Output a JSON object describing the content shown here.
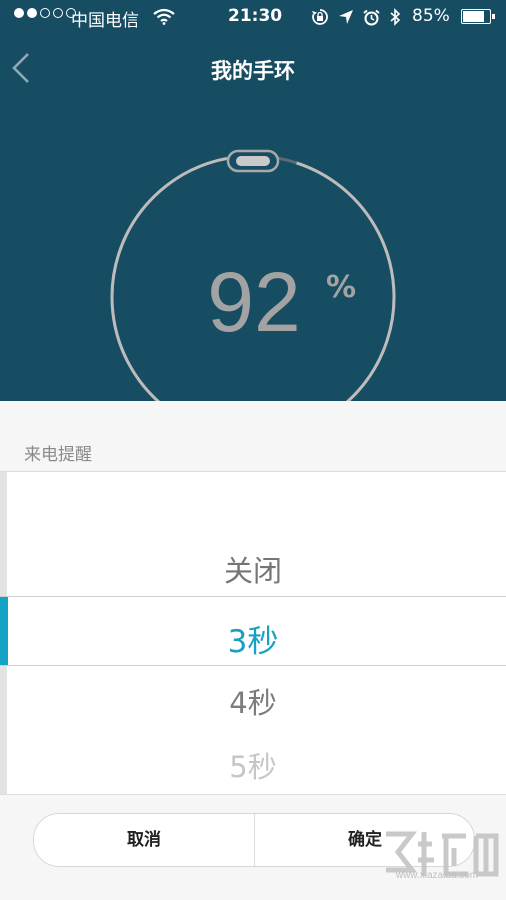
{
  "status_bar": {
    "carrier": "中国电信",
    "time": "21:30",
    "battery_percent": "85%",
    "battery_level": 0.85,
    "signal": {
      "filled": 2,
      "total": 5
    },
    "icons": [
      "wifi-icon",
      "orientation-lock-icon",
      "location-icon",
      "alarm-icon",
      "bluetooth-icon",
      "battery-icon"
    ]
  },
  "header": {
    "title": "我的手环"
  },
  "band": {
    "value": "92",
    "unit": "%",
    "level": 0.92
  },
  "sheet": {
    "label": "来电提醒",
    "options": [
      "关闭",
      "3秒",
      "4秒",
      "5秒"
    ],
    "selected": "3秒",
    "cancel_label": "取消",
    "confirm_label": "确定"
  },
  "watermark": {
    "url": "www.xiazaiba.com"
  },
  "colors": {
    "header_bg": "#174d62",
    "accent": "#16a2c2",
    "sheet_bg": "#f6f6f6"
  }
}
